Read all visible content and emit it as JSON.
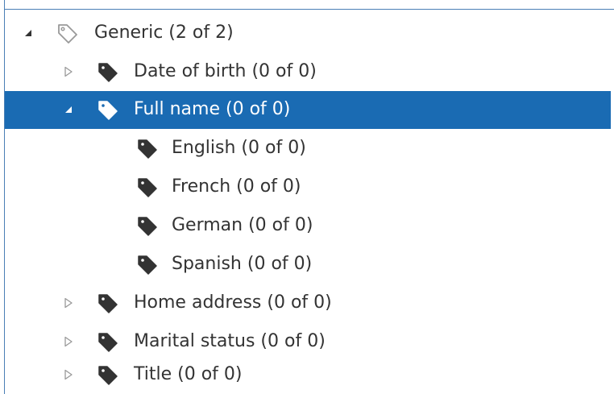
{
  "tree": {
    "root": {
      "label": "Generic (2 of 2)",
      "icon": "tag-outline-icon",
      "expanded": true
    },
    "items": [
      {
        "label": "Date of birth (0 of 0)",
        "icon": "tag-icon",
        "toggle": "collapsed"
      },
      {
        "label": "Full name (0 of 0)",
        "icon": "tag-icon",
        "toggle": "expanded",
        "selected": true
      },
      {
        "label": "English (0 of 0)",
        "icon": "tag-icon",
        "toggle": "none"
      },
      {
        "label": "French (0 of 0)",
        "icon": "tag-icon",
        "toggle": "none"
      },
      {
        "label": "German (0 of 0)",
        "icon": "tag-icon",
        "toggle": "none"
      },
      {
        "label": "Spanish (0 of 0)",
        "icon": "tag-icon",
        "toggle": "none"
      },
      {
        "label": "Home address (0 of 0)",
        "icon": "tag-icon",
        "toggle": "collapsed"
      },
      {
        "label": "Marital status (0 of 0)",
        "icon": "tag-icon",
        "toggle": "collapsed"
      },
      {
        "label": "Title (0 of 0)",
        "icon": "tag-icon",
        "toggle": "collapsed"
      }
    ]
  },
  "colors": {
    "selection_background": "#1a6bb3",
    "selection_text": "#ffffff",
    "text": "#333333",
    "tag_fill": "#333333",
    "collapsed_arrow": "#999999",
    "border": "#4a7fb5"
  }
}
